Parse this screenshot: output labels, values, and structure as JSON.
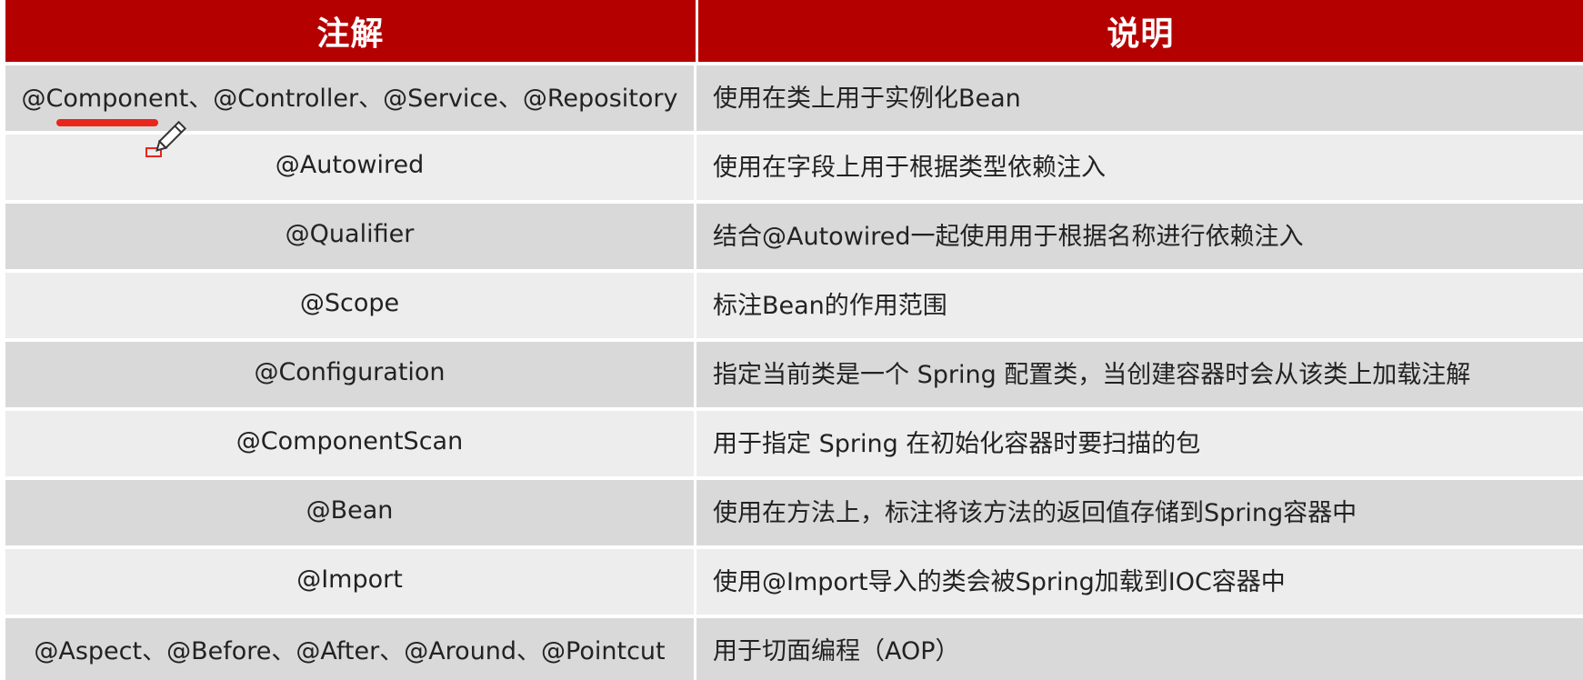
{
  "table": {
    "headers": {
      "annotation": "注解",
      "description": "说明"
    },
    "rows": [
      {
        "annotation": "@Component、@Controller、@Service、@Repository",
        "description": "使用在类上用于实例化Bean"
      },
      {
        "annotation": "@Autowired",
        "description": "使用在字段上用于根据类型依赖注入"
      },
      {
        "annotation": "@Qualifier",
        "description": "结合@Autowired一起使用用于根据名称进行依赖注入"
      },
      {
        "annotation": "@Scope",
        "description": "标注Bean的作用范围"
      },
      {
        "annotation": "@Configuration",
        "description": "指定当前类是一个 Spring 配置类，当创建容器时会从该类上加载注解"
      },
      {
        "annotation": "@ComponentScan",
        "description": "用于指定 Spring  在初始化容器时要扫描的包"
      },
      {
        "annotation": "@Bean",
        "description": "使用在方法上，标注将该方法的返回值存储到Spring容器中"
      },
      {
        "annotation": "@Import",
        "description": "使用@Import导入的类会被Spring加载到IOC容器中"
      },
      {
        "annotation": "@Aspect、@Before、@After、@Around、@Pointcut",
        "description": "用于切面编程（AOP）"
      }
    ]
  },
  "colors": {
    "header_bg": "#b50000",
    "row_odd": "#d9d9d9",
    "row_even": "#ededed",
    "pen_mark": "#e8261c"
  },
  "icons": {
    "pen": "pencil-cursor-icon"
  }
}
